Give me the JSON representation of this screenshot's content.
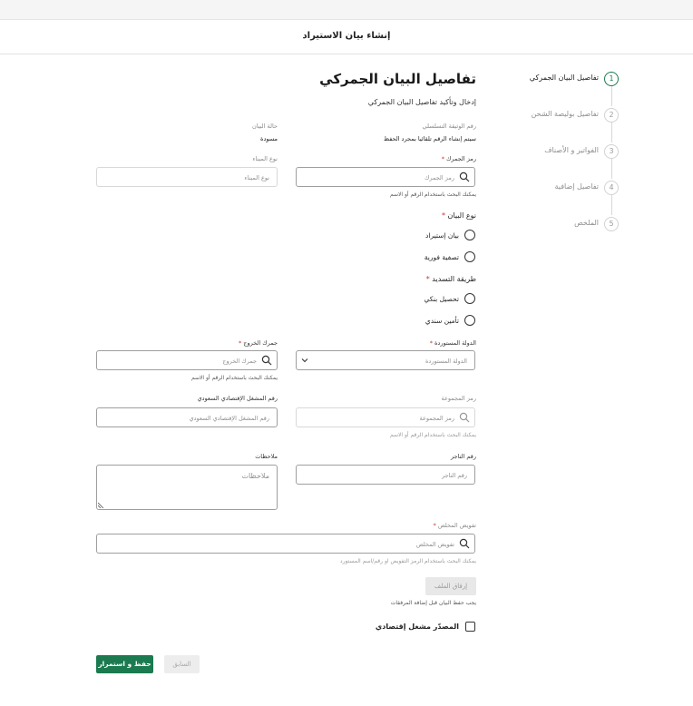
{
  "header": {
    "title": "إنشاء بيان الاستيراد"
  },
  "stepper": {
    "steps": [
      {
        "num": "1",
        "label": "تفاصيل البيان الجمركي"
      },
      {
        "num": "2",
        "label": "تفاصيل بوليصة الشحن"
      },
      {
        "num": "3",
        "label": "الفواتير و الأصناف"
      },
      {
        "num": "4",
        "label": "تفاصيل إضافية"
      },
      {
        "num": "5",
        "label": "الملخص"
      }
    ]
  },
  "form": {
    "title": "تفاصيل البيان الجمركي",
    "subtitle": "إدخال وتأكيد تفاصيل البيان الجمركي",
    "serial": {
      "label": "رقم الوثيقة التسلسلي",
      "value": "سيتم إنشاء الرقم تلقائيا بمجرد الحفظ"
    },
    "status": {
      "label": "حالة البيان",
      "value": "مسودة"
    },
    "customs_code": {
      "label": "رمز الجمرك",
      "placeholder": "رمز الجمرك",
      "hint": "يمكنك البحث باستخدام الرقم أو الاسم"
    },
    "port_type": {
      "label": "نوع الميناء",
      "placeholder": "نوع الميناء"
    },
    "declaration_type": {
      "label": "نوع البيان",
      "options": [
        "بيان إستيراد",
        "تصفية فورية"
      ]
    },
    "payment_method": {
      "label": "طريقة التسديد",
      "options": [
        "تحصيل بنكي",
        "تأمين سندي"
      ]
    },
    "importing_country": {
      "label": "الدولة المستوردة",
      "placeholder": "الدولة المستوردة"
    },
    "exit_customs": {
      "label": "جمرك الخروج",
      "placeholder": "جمرك الخروج",
      "hint": "يمكنك البحث باستخدام الرقم أو الاسم"
    },
    "group_code": {
      "label": "رمز المجموعة",
      "placeholder": "رمز المجموعة",
      "hint": "يمكنك البحث باستخدام الرقم أو الاسم"
    },
    "saudi_operator": {
      "label": "رقم المشغل الإقتصادي السعودي",
      "placeholder": "رقم المشغل الإقتصادي السعودي"
    },
    "merchant_number": {
      "label": "رقم التاجر",
      "placeholder": "رقم التاجر"
    },
    "notes": {
      "label": "ملاحظات",
      "placeholder": "ملاحظات"
    },
    "broker_authorization": {
      "label": "تفويض المخلص",
      "placeholder": "تفويض المخلص",
      "hint": "يمكنك البحث باستخدام الرمز التفويض او رقم/اسم المستورد"
    },
    "attach": {
      "label": "إرفاق الملف",
      "hint": "يجب حفظ البيان قبل إضافة المرفقات"
    },
    "economic_operator": {
      "label": "المصدّر مشغل إقتصادي"
    }
  },
  "footer": {
    "save_continue": "حفظ و استمرار",
    "previous": "السابق"
  },
  "colors": {
    "accent": "#1b7a4f",
    "required": "#c0392b"
  }
}
